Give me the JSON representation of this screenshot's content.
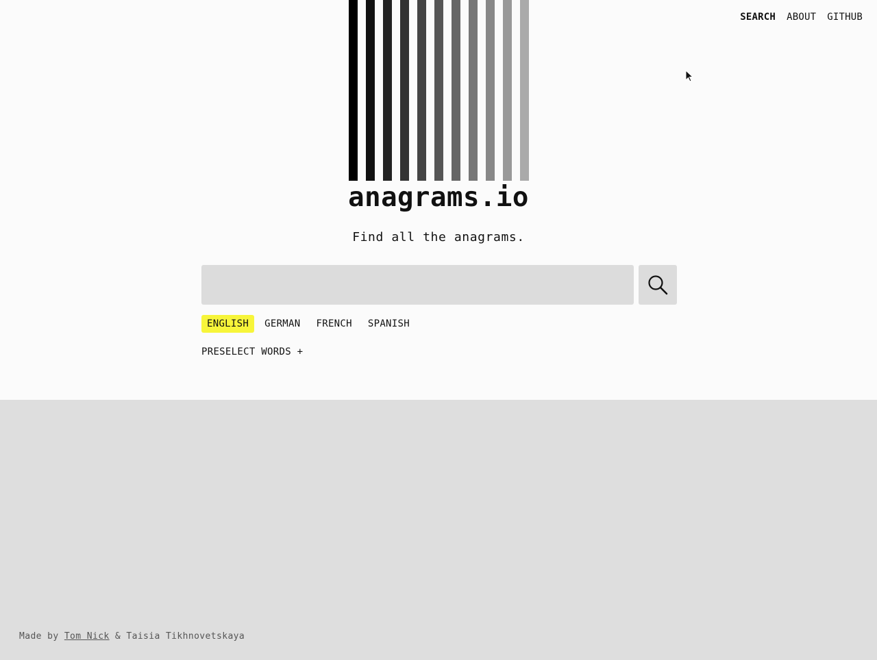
{
  "nav": {
    "search": "SEARCH",
    "about": "ABOUT",
    "github": "GITHUB"
  },
  "logo": {
    "bar_colors": [
      "#000000",
      "#111111",
      "#222222",
      "#333333",
      "#444444",
      "#555555",
      "#666666",
      "#777777",
      "#888888",
      "#999999",
      "#aaaaaa"
    ]
  },
  "brand": {
    "title": "anagrams.io",
    "tagline": "Find all the anagrams."
  },
  "search": {
    "value": "",
    "placeholder": "",
    "button_icon": "search-icon"
  },
  "languages": {
    "items": [
      "ENGLISH",
      "GERMAN",
      "FRENCH",
      "SPANISH"
    ],
    "selected": "ENGLISH",
    "highlight_color": "#f7f53a"
  },
  "preselect": {
    "label": "PRESELECT WORDS +"
  },
  "footer": {
    "made_by": "Made by",
    "author1": "Tom Nick",
    "separator": "&",
    "author2": "Taisia Tikhnovetskaya"
  },
  "colors": {
    "page_bg": "#fbfbfb",
    "results_bg": "#dedede",
    "input_bg": "#dcdcdc"
  }
}
